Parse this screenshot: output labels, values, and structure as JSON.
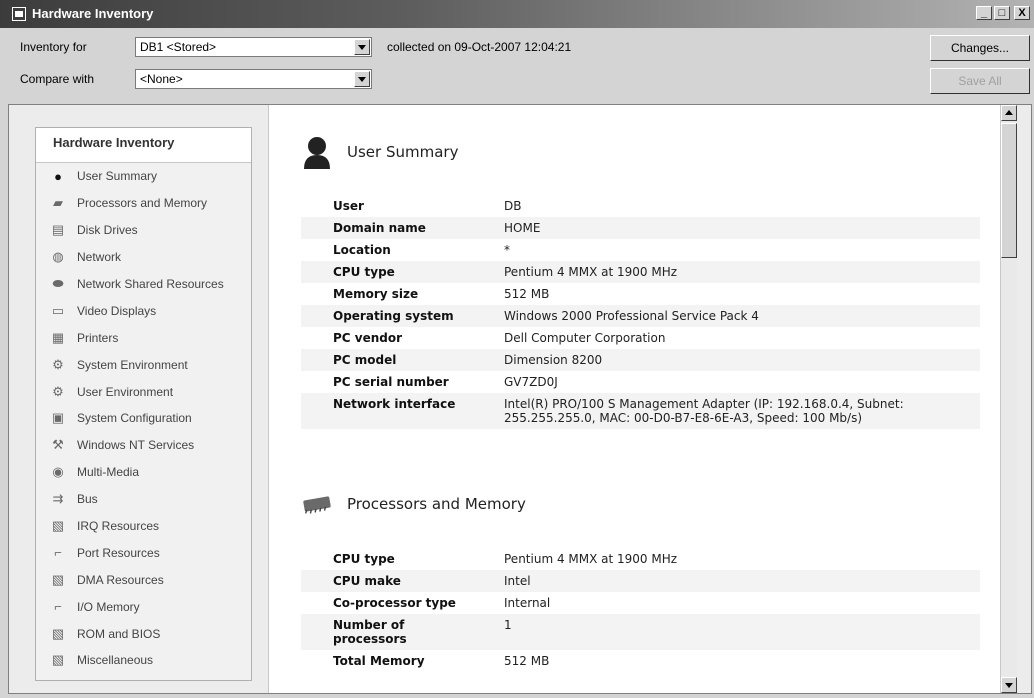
{
  "window": {
    "title": "Hardware Inventory",
    "buttons": {
      "minimize": "_",
      "maximize": "□",
      "close": "X"
    }
  },
  "toolbar": {
    "inventory_for_label": "Inventory for",
    "inventory_for_value": "DB1 <Stored>",
    "collected_text": "collected on 09-Oct-2007 12:04:21",
    "compare_with_label": "Compare with",
    "compare_with_value": "<None>",
    "changes_button": "Changes...",
    "save_all_button": "Save All"
  },
  "sidebar": {
    "header": "Hardware Inventory",
    "items": [
      {
        "label": "User Summary",
        "icon": "user-icon"
      },
      {
        "label": "Processors and Memory",
        "icon": "chip-icon"
      },
      {
        "label": "Disk Drives",
        "icon": "disk-icon"
      },
      {
        "label": "Network",
        "icon": "globe-icon"
      },
      {
        "label": "Network Shared Resources",
        "icon": "share-icon"
      },
      {
        "label": "Video Displays",
        "icon": "monitor-icon"
      },
      {
        "label": "Printers",
        "icon": "printer-icon"
      },
      {
        "label": "System Environment",
        "icon": "settings-icon"
      },
      {
        "label": "User Environment",
        "icon": "settings-icon"
      },
      {
        "label": "System Configuration",
        "icon": "config-icon"
      },
      {
        "label": "Windows NT Services",
        "icon": "services-icon"
      },
      {
        "label": "Multi-Media",
        "icon": "media-icon"
      },
      {
        "label": "Bus",
        "icon": "usb-icon"
      },
      {
        "label": "IRQ Resources",
        "icon": "resource-icon"
      },
      {
        "label": "Port Resources",
        "icon": "port-icon"
      },
      {
        "label": "DMA Resources",
        "icon": "resource-icon"
      },
      {
        "label": "I/O Memory",
        "icon": "port-icon"
      },
      {
        "label": "ROM and BIOS",
        "icon": "resource-icon"
      },
      {
        "label": "Miscellaneous",
        "icon": "resource-icon"
      }
    ]
  },
  "main": {
    "user_summary": {
      "title": "User Summary",
      "rows": [
        {
          "k": "User",
          "v": "DB"
        },
        {
          "k": "Domain name",
          "v": "HOME"
        },
        {
          "k": "Location",
          "v": "*"
        },
        {
          "k": "CPU type",
          "v": "Pentium 4 MMX at 1900 MHz"
        },
        {
          "k": "Memory size",
          "v": "512 MB"
        },
        {
          "k": "Operating system",
          "v": "Windows 2000 Professional Service Pack 4"
        },
        {
          "k": "PC vendor",
          "v": "Dell Computer Corporation"
        },
        {
          "k": "PC model",
          "v": "Dimension 8200"
        },
        {
          "k": "PC serial number",
          "v": "GV7ZD0J"
        },
        {
          "k": "Network interface",
          "v": "Intel(R) PRO/100 S Management Adapter (IP: 192.168.0.4, Subnet: 255.255.255.0, MAC: 00-D0-B7-E8-6E-A3, Speed: 100 Mb/s)"
        }
      ]
    },
    "processors": {
      "title": "Processors and Memory",
      "rows": [
        {
          "k": "CPU type",
          "v": "Pentium 4 MMX at 1900 MHz"
        },
        {
          "k": "CPU make",
          "v": "Intel"
        },
        {
          "k": "Co-processor type",
          "v": "Internal"
        },
        {
          "k": "Number of processors",
          "v": "1"
        },
        {
          "k": "Total Memory",
          "v": "512 MB"
        }
      ]
    }
  }
}
